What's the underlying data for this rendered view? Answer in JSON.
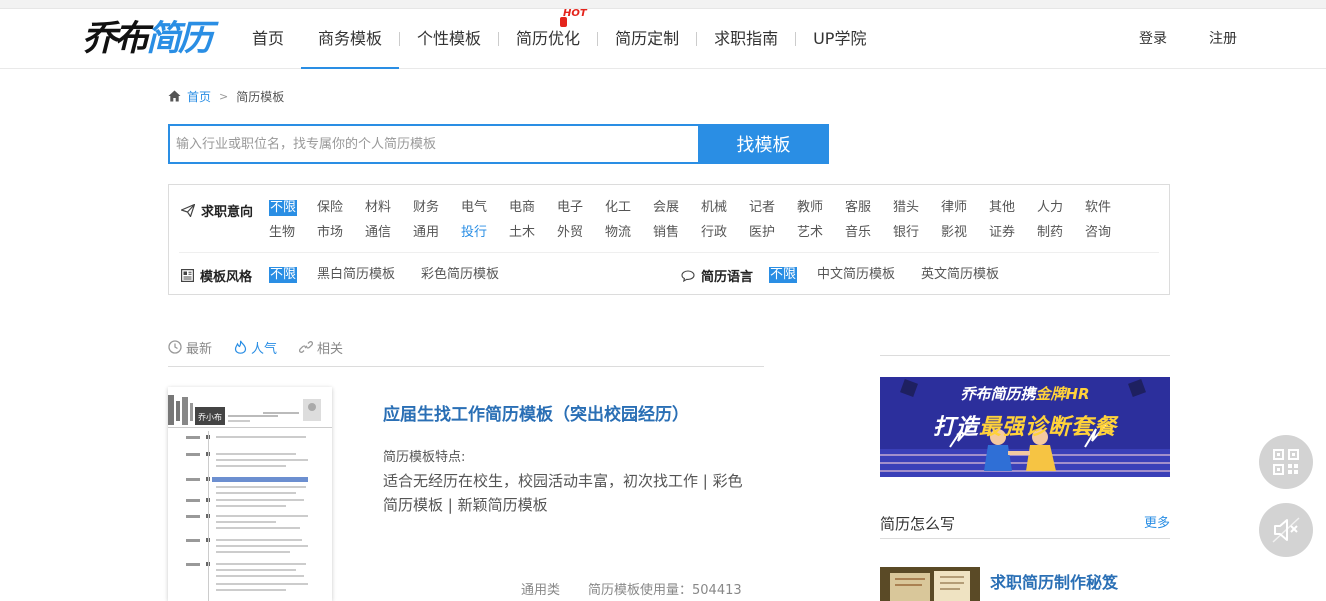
{
  "logo": {
    "part1": "乔布",
    "part2": "简历"
  },
  "nav": {
    "items": [
      "首页",
      "商务模板",
      "个性模板",
      "简历优化",
      "简历定制",
      "求职指南",
      "UP学院"
    ],
    "hot_badge": "HOT",
    "login": "登录",
    "register": "注册"
  },
  "breadcrumb": {
    "home": "首页",
    "separator": ">",
    "current": "简历模板"
  },
  "search": {
    "placeholder": "输入行业或职位名，找专属你的个人简历模板",
    "value": "",
    "button": "找模板"
  },
  "filters": {
    "job_label": "求职意向",
    "job_row1": [
      "不限",
      "保险",
      "材料",
      "财务",
      "电气",
      "电商",
      "电子",
      "化工",
      "会展",
      "机械",
      "记者",
      "教师",
      "客服",
      "猎头",
      "律师",
      "其他",
      "人力",
      "软件"
    ],
    "job_row2": [
      "生物",
      "市场",
      "通信",
      "通用",
      "投行",
      "土木",
      "外贸",
      "物流",
      "销售",
      "行政",
      "医护",
      "艺术",
      "音乐",
      "银行",
      "影视",
      "证券",
      "制药",
      "咨询"
    ],
    "style_label": "模板风格",
    "style_options": [
      "不限",
      "黑白简历模板",
      "彩色简历模板"
    ],
    "lang_label": "简历语言",
    "lang_options": [
      "不限",
      "中文简历模板",
      "英文简历模板"
    ]
  },
  "sort_tabs": [
    "最新",
    "人气",
    "相关"
  ],
  "result": {
    "title": "应届生找工作简历模板（突出校园经历）",
    "feature_label": "简历模板特点:",
    "description": "适合无经历在校生，校园活动丰富，初次找工作 | 彩色简历模板 | 新颖简历模板",
    "category": "通用类",
    "usage": "简历模板使用量：504413",
    "thumb_name": "乔小布"
  },
  "sidebar": {
    "banner_line1_a": "乔布简历携",
    "banner_line1_b": "金牌HR",
    "banner_line2_a": "打造",
    "banner_line2_b": "最强诊断套餐",
    "section_title": "简历怎么写",
    "more": "更多",
    "article_title": "求职简历制作秘笈"
  },
  "colors": {
    "accent": "#2a8ee4",
    "title_blue": "#2a6fb5",
    "hot": "#e4241c",
    "banner_bg": "#2c2f9c",
    "banner_gold": "#ffd23a"
  },
  "icons": [
    "home-icon",
    "send-icon",
    "template-icon",
    "chat-bubble-icon",
    "clock-icon",
    "fire-icon",
    "link-icon",
    "qrcode-icon",
    "speaker-muted-icon"
  ]
}
